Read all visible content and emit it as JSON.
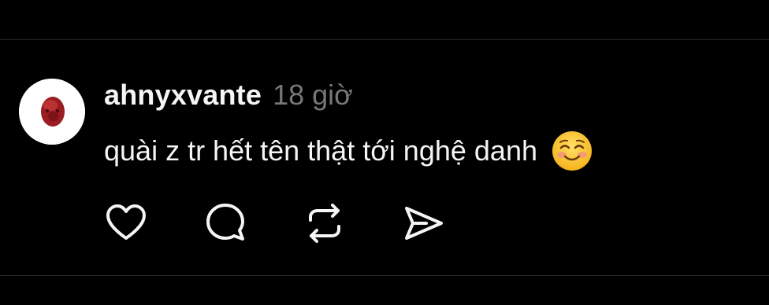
{
  "comment": {
    "username": "ahnyxvante",
    "timestamp": "18 giờ",
    "text": "quài z tr hết tên thật tới nghệ danh",
    "emoji": "smiling-face-icon"
  },
  "actions": [
    {
      "icon": "heart-icon"
    },
    {
      "icon": "comment-icon"
    },
    {
      "icon": "repost-icon"
    },
    {
      "icon": "share-icon"
    }
  ],
  "colors": {
    "background": "#000000",
    "text": "#f3f5f7",
    "muted": "#777777",
    "divider": "#262626"
  }
}
